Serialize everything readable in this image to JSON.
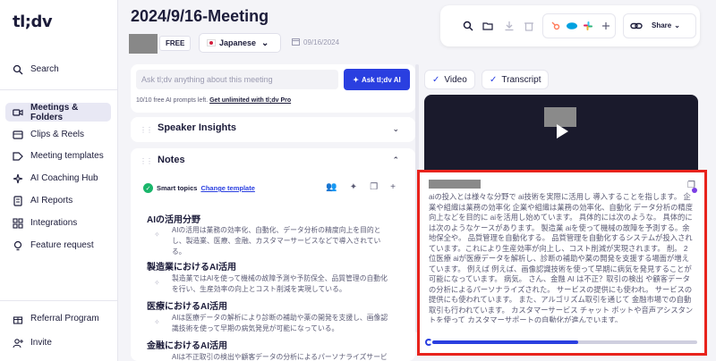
{
  "app": {
    "logo": "tl;dv"
  },
  "sidebar": {
    "items": [
      {
        "label": "Search",
        "icon": "search-icon",
        "active": false
      },
      {
        "label": "Meetings & Folders",
        "icon": "video-camera-icon",
        "active": true
      },
      {
        "label": "Clips & Reels",
        "icon": "clips-icon",
        "active": false
      },
      {
        "label": "Meeting templates",
        "icon": "template-icon",
        "active": false
      },
      {
        "label": "AI Coaching Hub",
        "icon": "coaching-icon",
        "active": false
      },
      {
        "label": "AI Reports",
        "icon": "reports-icon",
        "active": false
      },
      {
        "label": "Integrations",
        "icon": "integrations-icon",
        "active": false
      },
      {
        "label": "Feature request",
        "icon": "lightbulb-icon",
        "active": false
      }
    ],
    "bottom": [
      {
        "label": "Referral Program",
        "icon": "gift-icon"
      },
      {
        "label": "Invite",
        "icon": "user-plus-icon"
      }
    ]
  },
  "header": {
    "title": "2024/9/16-Meeting",
    "plan_badge": "FREE",
    "language": "Japanese",
    "date": "09/16/2024"
  },
  "toolbar": {
    "share_label": "Share"
  },
  "ask": {
    "placeholder": "Ask tl;dv anything about this meeting",
    "button_label": "Ask tl;dv AI",
    "prompts_note": "10/10 free AI prompts left.",
    "prompts_link": "Get unlimited with tl;dv Pro"
  },
  "speaker_insights": {
    "title": "Speaker Insights"
  },
  "notes": {
    "title": "Notes",
    "smart_topics_label": "Smart topics",
    "change_template_link": "Change template",
    "sections": [
      {
        "heading": "AIの活用分野",
        "text": "AIの活用は業務の効率化、自動化、データ分析の精度向上を目的とし、製造業、医療、金融、カスタマーサービスなどで導入されている。"
      },
      {
        "heading": "製造業におけるAI活用",
        "text": "製造業ではAIを使って機械の故障予測や予防保全、品質管理の自動化を行い、生産効率の向上とコスト削減を実現している。"
      },
      {
        "heading": "医療におけるAI活用",
        "text": "AIは医療データの解析により診断の補助や薬の開発を支援し、画像認識技術を使って早期の病気発見が可能になっている。"
      },
      {
        "heading": "金融におけるAI活用",
        "text": "AIは不正取引の検出や顧客データの分析によるパーソナライズサービ"
      }
    ]
  },
  "tabs": {
    "video": "Video",
    "transcript": "Transcript"
  },
  "transcript": {
    "text": "aiの投入とは様々な分野で ai技術を実際に活用し 導入することを指します。 企業や組織は業務の効率化 企業や組織は業務の効率化、自動化 データ分析の精度向上などを目的に aiを活用し始めています。 具体的には次のような。 具体的には次のようなケースがあります。 製造業 aiを使って機械の故障を予測する。余地保全や。 品質管理を自動化する。 品質管理を自動化するシステムが投入されています。これにより生産効率が向上し、コスト削減が実現されます。 削。 2位医療 aiが医療データを解析し、診断の補助や薬の開発を支援する場面が増えています。 例えば 例えば、画像認識技術を使って早期に病気を発見することが可能になっています。 病気。 さん、金融 AI は不正？取引の検出 や顧客データの分析によるパーソナライズされた。 サービスの提供にも使われ。 サービスの提供にも使われています。 また、アルゴリズム取引を通じて 金融市場での自動取引も行われています。 カスタマーサービス チャット ボットや音声アシスタントを使って カスタマーサポートの自動化が進んでいます。",
    "progress": 0.55
  },
  "colors": {
    "accent": "#2a3fe0",
    "highlight_border": "#e8231c",
    "success": "#1ab66b"
  }
}
